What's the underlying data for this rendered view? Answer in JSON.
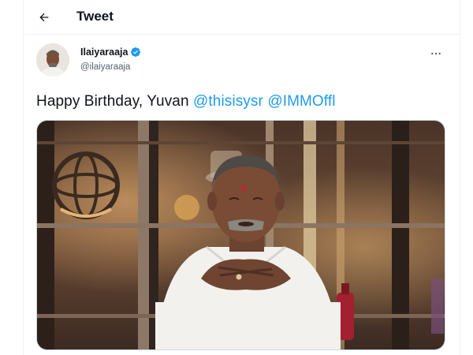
{
  "header": {
    "title": "Tweet",
    "back_icon": "arrow-left-icon"
  },
  "author": {
    "display_name": "Ilaiyaraaja",
    "handle": "@ilaiyaraaja",
    "verified": true,
    "verified_color": "#1d9bf0",
    "more_icon": "more-horizontal-icon"
  },
  "tweet": {
    "text_prefix": "Happy Birthday, Yuvan ",
    "mentions": [
      "@thisisysr",
      "@IMMOffl"
    ],
    "mention_color": "#1d9bf0"
  },
  "media": {
    "type": "photo"
  }
}
